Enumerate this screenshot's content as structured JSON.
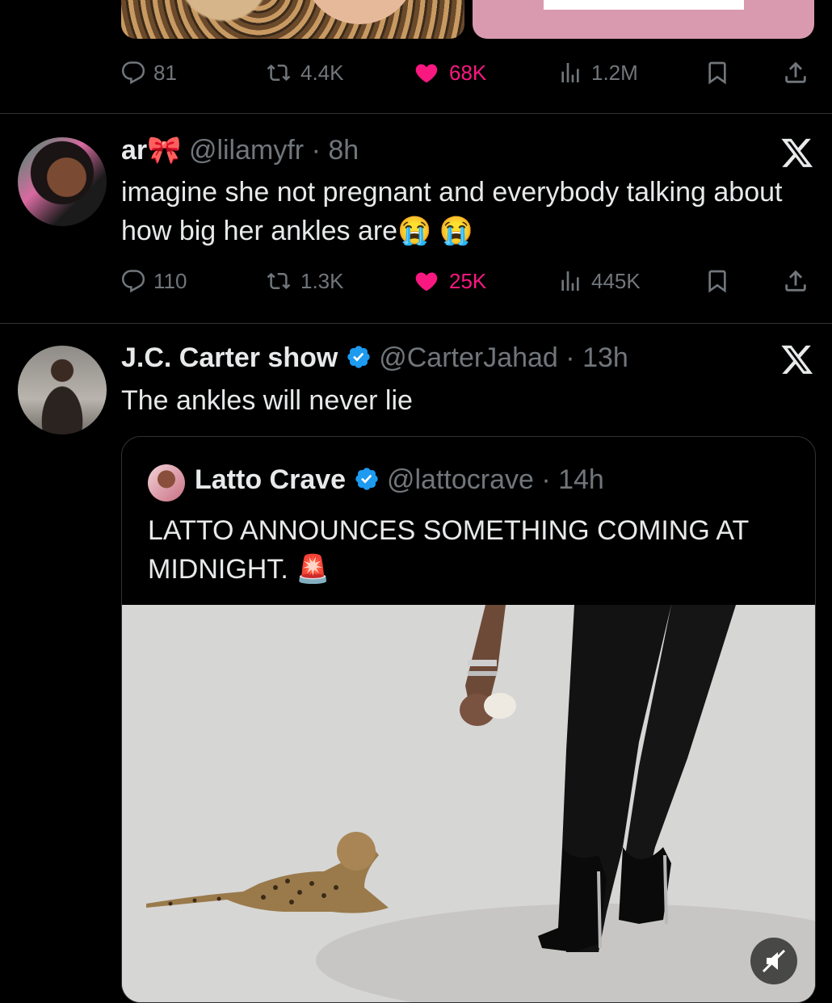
{
  "posts": [
    {
      "stats": {
        "replies": "81",
        "reposts": "4.4K",
        "likes": "68K",
        "views": "1.2M"
      }
    },
    {
      "display_name": "ar🎀",
      "handle": "@lilamyfr",
      "time": "8h",
      "text": "imagine she not pregnant and everybody talking about how big her ankles are😭 😭",
      "stats": {
        "replies": "110",
        "reposts": "1.3K",
        "likes": "25K",
        "views": "445K"
      }
    },
    {
      "display_name": "J.C. Carter show",
      "handle": "@CarterJahad",
      "time": "13h",
      "text": "The ankles will never lie",
      "quote": {
        "display_name": "Latto Crave",
        "handle": "@lattocrave",
        "time": "14h",
        "text": "LATTO ANNOUNCES SOMETHING COMING AT MIDNIGHT. 🚨"
      }
    }
  ],
  "icons": {
    "reply": "reply-icon",
    "repost": "repost-icon",
    "like": "heart-icon",
    "views": "views-icon",
    "bookmark": "bookmark-icon",
    "share": "share-icon",
    "close": "x-close-icon",
    "verified": "verified-badge-icon",
    "mute": "mute-icon"
  },
  "colors": {
    "background": "#000000",
    "text": "#e7e9ea",
    "muted": "#71767b",
    "like": "#f91880",
    "verified": "#1d9bf0",
    "divider": "#2f3336"
  }
}
